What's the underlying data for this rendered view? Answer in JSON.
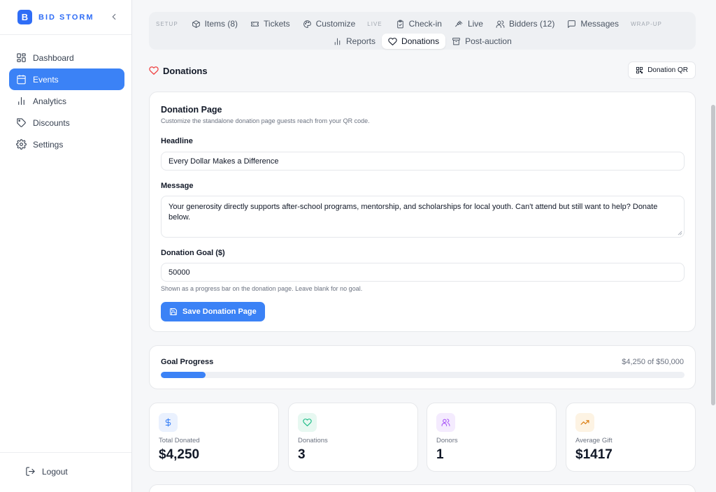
{
  "brand": {
    "logo_letter": "B",
    "name": "BID STORM",
    "accent": "#2f6df6"
  },
  "sidebar": {
    "items": [
      {
        "label": "Dashboard",
        "icon": "grid-icon",
        "active": false
      },
      {
        "label": "Events",
        "icon": "calendar-icon",
        "active": true
      },
      {
        "label": "Analytics",
        "icon": "bar-chart-icon",
        "active": false
      },
      {
        "label": "Discounts",
        "icon": "tag-icon",
        "active": false
      },
      {
        "label": "Settings",
        "icon": "gear-icon",
        "active": false
      }
    ],
    "logout_label": "Logout"
  },
  "tabs": {
    "sections": {
      "setup": "SETUP",
      "live": "LIVE",
      "wrapup": "WRAP-UP"
    },
    "items": {
      "items": "Items (8)",
      "tickets": "Tickets",
      "customize": "Customize",
      "checkin": "Check-in",
      "live": "Live",
      "bidders": "Bidders (12)",
      "messages": "Messages",
      "reports": "Reports",
      "donations": "Donations",
      "postauction": "Post-auction"
    },
    "active": "Donations"
  },
  "page": {
    "title": "Donations",
    "qr_button": "Donation QR"
  },
  "donation_page": {
    "title": "Donation Page",
    "subtitle": "Customize the standalone donation page guests reach from your QR code.",
    "headline_label": "Headline",
    "headline_value": "Every Dollar Makes a Difference",
    "message_label": "Message",
    "message_value": "Your generosity directly supports after-school programs, mentorship, and scholarships for local youth. Can't attend but still want to help? Donate below.",
    "goal_label": "Donation Goal ($)",
    "goal_value": "50000",
    "goal_hint": "Shown as a progress bar on the donation page. Leave blank for no goal.",
    "save_label": "Save Donation Page"
  },
  "goal_progress": {
    "label": "Goal Progress",
    "amount_text": "$4,250 of $50,000",
    "fraction": 0.085
  },
  "stats": [
    {
      "label": "Total Donated",
      "value": "$4,250",
      "icon": "dollar-icon",
      "color": "#3b82f6",
      "bg": "#eaf1fe"
    },
    {
      "label": "Donations",
      "value": "3",
      "icon": "heart-icon",
      "color": "#10b981",
      "bg": "#e7f8f1"
    },
    {
      "label": "Donors",
      "value": "1",
      "icon": "users-icon",
      "color": "#a855f7",
      "bg": "#f4ebfe"
    },
    {
      "label": "Average Gift",
      "value": "$1417",
      "icon": "trending-up-icon",
      "color": "#d97706",
      "bg": "#fdf3e3"
    }
  ]
}
